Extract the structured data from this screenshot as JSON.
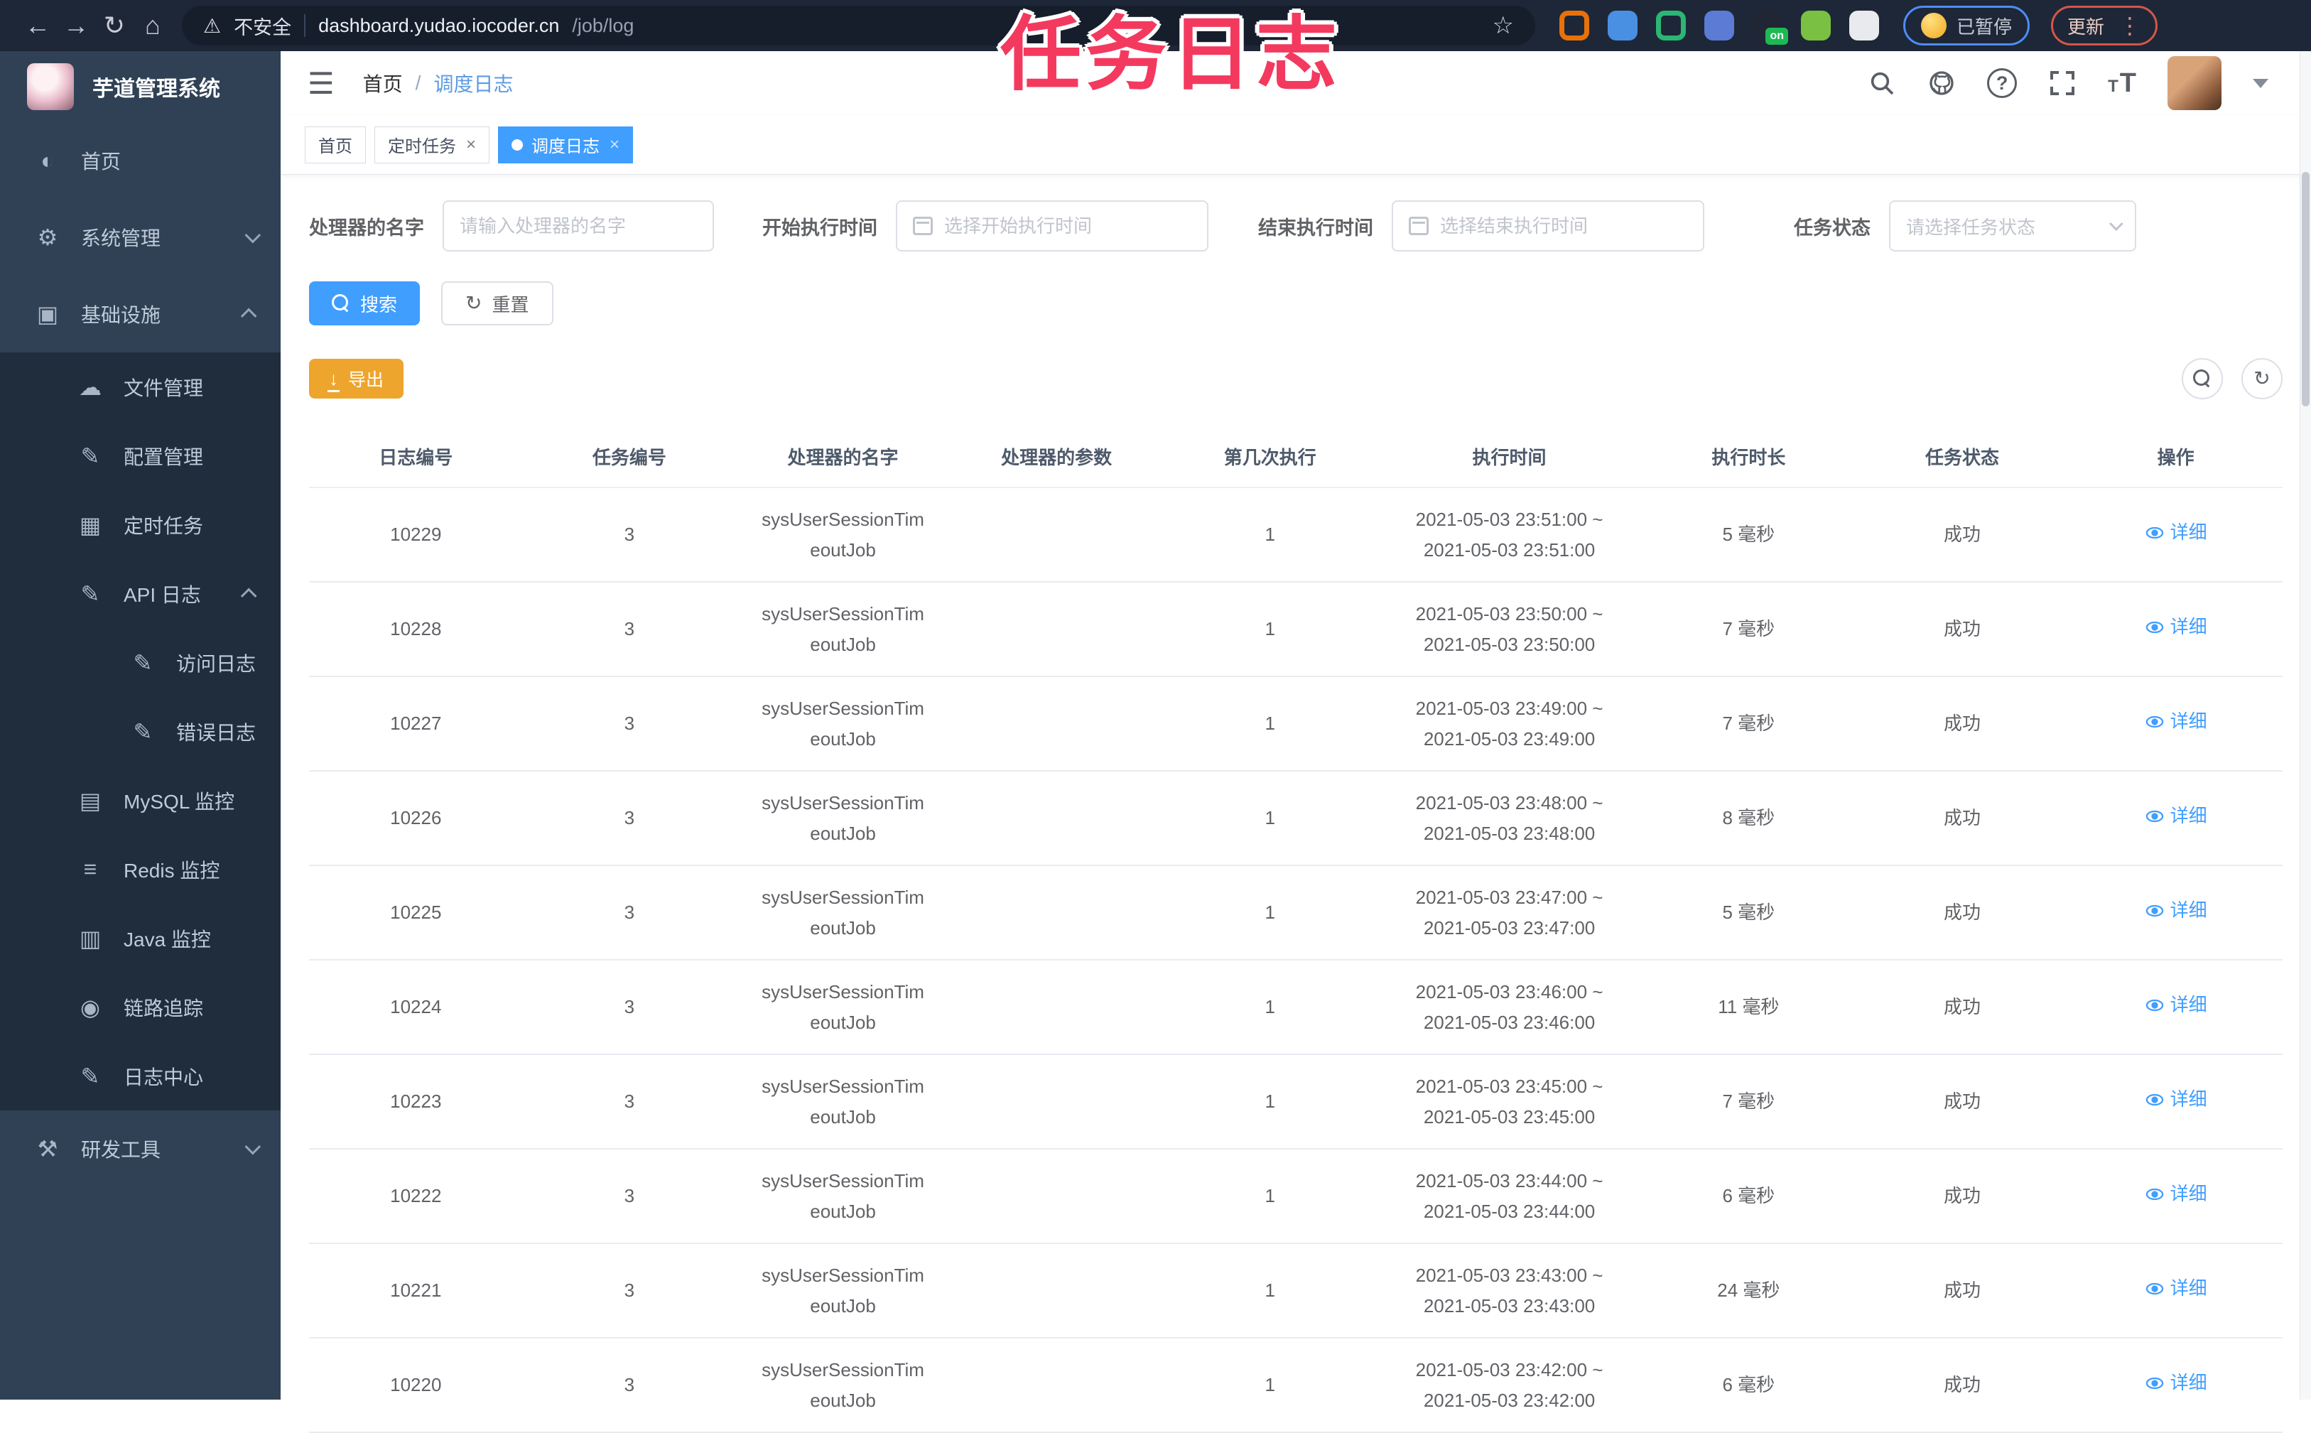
{
  "browser": {
    "security_label": "不安全",
    "url_host": "dashboard.yudao.iocoder.cn",
    "url_path": "/job/log",
    "paused_label": "已暂停",
    "update_label": "更新",
    "extensions": [
      {
        "name": "orange-ring-icon",
        "color": "#e8710a",
        "shape": "ring"
      },
      {
        "name": "blue-pin-icon",
        "color": "#4a90e2",
        "shape": "dot"
      },
      {
        "name": "green-badge-icon",
        "color": "#2bb673",
        "shape": "ring"
      },
      {
        "name": "grid-icon",
        "color": "#5b7bd5",
        "shape": "dot"
      },
      {
        "name": "on-badge-icon",
        "color": "#1db954",
        "shape": "badge",
        "label": "on"
      },
      {
        "name": "leaf-icon",
        "color": "#7ac143",
        "shape": "dot"
      },
      {
        "name": "puzzle-icon",
        "color": "#e8eaed",
        "shape": "dot"
      }
    ]
  },
  "overlay": {
    "title": "任务日志",
    "color": "#f4395f"
  },
  "sidebar": {
    "logo_title": "芋道管理系统",
    "items": [
      {
        "label": "首页",
        "icon": "dashboard-icon",
        "depth": 0,
        "arrow": null
      },
      {
        "label": "系统管理",
        "icon": "gear-icon",
        "depth": 0,
        "arrow": "down"
      },
      {
        "label": "基础设施",
        "icon": "infrastructure-icon",
        "depth": 0,
        "arrow": "up"
      },
      {
        "label": "文件管理",
        "icon": "file-upload-icon",
        "depth": 1,
        "arrow": null
      },
      {
        "label": "配置管理",
        "icon": "edit-icon",
        "depth": 1,
        "arrow": null
      },
      {
        "label": "定时任务",
        "icon": "task-icon",
        "depth": 1,
        "arrow": null
      },
      {
        "label": "API 日志",
        "icon": "log-icon",
        "depth": 1,
        "arrow": "up"
      },
      {
        "label": "访问日志",
        "icon": "log-icon",
        "depth": 2,
        "arrow": null
      },
      {
        "label": "错误日志",
        "icon": "log-icon",
        "depth": 2,
        "arrow": null
      },
      {
        "label": "MySQL 监控",
        "icon": "mysql-icon",
        "depth": 1,
        "arrow": null
      },
      {
        "label": "Redis 监控",
        "icon": "redis-icon",
        "depth": 1,
        "arrow": null
      },
      {
        "label": "Java 监控",
        "icon": "java-icon",
        "depth": 1,
        "arrow": null
      },
      {
        "label": "链路追踪",
        "icon": "eye-icon",
        "depth": 1,
        "arrow": null
      },
      {
        "label": "日志中心",
        "icon": "log-icon",
        "depth": 1,
        "arrow": null
      },
      {
        "label": "研发工具",
        "icon": "tools-icon",
        "depth": 0,
        "arrow": "down"
      }
    ]
  },
  "header": {
    "breadcrumb": {
      "home": "首页",
      "current": "调度日志"
    }
  },
  "tabs": [
    {
      "label": "首页",
      "active": false,
      "closable": false
    },
    {
      "label": "定时任务",
      "active": false,
      "closable": true
    },
    {
      "label": "调度日志",
      "active": true,
      "closable": true
    }
  ],
  "filters": {
    "handler_name": {
      "label": "处理器的名字",
      "placeholder": "请输入处理器的名字"
    },
    "begin_time": {
      "label": "开始执行时间",
      "placeholder": "选择开始执行时间"
    },
    "end_time": {
      "label": "结束执行时间",
      "placeholder": "选择结束执行时间"
    },
    "status": {
      "label": "任务状态",
      "placeholder": "请选择任务状态"
    }
  },
  "actions": {
    "search": "搜索",
    "reset": "重置",
    "export": "导出"
  },
  "table": {
    "columns": [
      "日志编号",
      "任务编号",
      "处理器的名字",
      "处理器的参数",
      "第几次执行",
      "执行时间",
      "执行时长",
      "任务状态",
      "操作"
    ],
    "detail_label": "详细",
    "rows": [
      {
        "log_id": "10229",
        "job_id": "3",
        "handler": [
          "sysUserSessionTim",
          "eoutJob"
        ],
        "param": "",
        "exec_index": "1",
        "time": [
          "2021-05-03 23:51:00 ~",
          "2021-05-03 23:51:00"
        ],
        "duration": "5 毫秒",
        "status": "成功"
      },
      {
        "log_id": "10228",
        "job_id": "3",
        "handler": [
          "sysUserSessionTim",
          "eoutJob"
        ],
        "param": "",
        "exec_index": "1",
        "time": [
          "2021-05-03 23:50:00 ~",
          "2021-05-03 23:50:00"
        ],
        "duration": "7 毫秒",
        "status": "成功"
      },
      {
        "log_id": "10227",
        "job_id": "3",
        "handler": [
          "sysUserSessionTim",
          "eoutJob"
        ],
        "param": "",
        "exec_index": "1",
        "time": [
          "2021-05-03 23:49:00 ~",
          "2021-05-03 23:49:00"
        ],
        "duration": "7 毫秒",
        "status": "成功"
      },
      {
        "log_id": "10226",
        "job_id": "3",
        "handler": [
          "sysUserSessionTim",
          "eoutJob"
        ],
        "param": "",
        "exec_index": "1",
        "time": [
          "2021-05-03 23:48:00 ~",
          "2021-05-03 23:48:00"
        ],
        "duration": "8 毫秒",
        "status": "成功"
      },
      {
        "log_id": "10225",
        "job_id": "3",
        "handler": [
          "sysUserSessionTim",
          "eoutJob"
        ],
        "param": "",
        "exec_index": "1",
        "time": [
          "2021-05-03 23:47:00 ~",
          "2021-05-03 23:47:00"
        ],
        "duration": "5 毫秒",
        "status": "成功"
      },
      {
        "log_id": "10224",
        "job_id": "3",
        "handler": [
          "sysUserSessionTim",
          "eoutJob"
        ],
        "param": "",
        "exec_index": "1",
        "time": [
          "2021-05-03 23:46:00 ~",
          "2021-05-03 23:46:00"
        ],
        "duration": "11 毫秒",
        "status": "成功"
      },
      {
        "log_id": "10223",
        "job_id": "3",
        "handler": [
          "sysUserSessionTim",
          "eoutJob"
        ],
        "param": "",
        "exec_index": "1",
        "time": [
          "2021-05-03 23:45:00 ~",
          "2021-05-03 23:45:00"
        ],
        "duration": "7 毫秒",
        "status": "成功"
      },
      {
        "log_id": "10222",
        "job_id": "3",
        "handler": [
          "sysUserSessionTim",
          "eoutJob"
        ],
        "param": "",
        "exec_index": "1",
        "time": [
          "2021-05-03 23:44:00 ~",
          "2021-05-03 23:44:00"
        ],
        "duration": "6 毫秒",
        "status": "成功"
      },
      {
        "log_id": "10221",
        "job_id": "3",
        "handler": [
          "sysUserSessionTim",
          "eoutJob"
        ],
        "param": "",
        "exec_index": "1",
        "time": [
          "2021-05-03 23:43:00 ~",
          "2021-05-03 23:43:00"
        ],
        "duration": "24 毫秒",
        "status": "成功"
      },
      {
        "log_id": "10220",
        "job_id": "3",
        "handler": [
          "sysUserSessionTim",
          "eoutJob"
        ],
        "param": "",
        "exec_index": "1",
        "time": [
          "2021-05-03 23:42:00 ~",
          "2021-05-03 23:42:00"
        ],
        "duration": "6 毫秒",
        "status": "成功"
      }
    ]
  },
  "colors": {
    "accent": "#409eff",
    "warning": "#eda52e",
    "sidebar_bg": "#304156",
    "submenu_bg": "#1f2d3d",
    "chrome_bg": "#1e2737",
    "overlay_text": "#f4395f"
  }
}
